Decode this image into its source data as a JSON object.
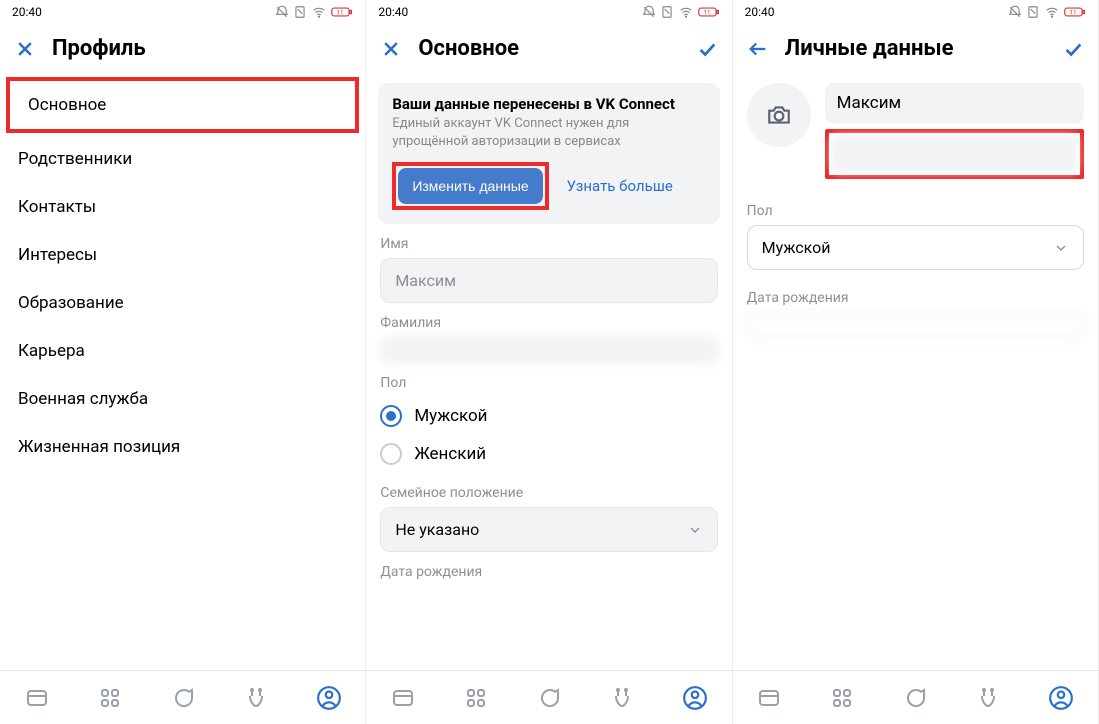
{
  "status": {
    "time": "20:40"
  },
  "panel1": {
    "title": "Профиль",
    "items": [
      "Основное",
      "Родственники",
      "Контакты",
      "Интересы",
      "Образование",
      "Карьера",
      "Военная служба",
      "Жизненная позиция"
    ]
  },
  "panel2": {
    "title": "Основное",
    "notice": {
      "title": "Ваши данные перенесены в VK Connect",
      "sub": "Единый аккаунт VK Connect нужен для упрощённой авторизации в сервисах",
      "primary": "Изменить данные",
      "link": "Узнать больше"
    },
    "name_label": "Имя",
    "name_value": "Максим",
    "surname_label": "Фамилия",
    "surname_value": " ",
    "gender_label": "Пол",
    "gender_male": "Мужской",
    "gender_female": "Женский",
    "marital_label": "Семейное положение",
    "marital_value": "Не указано",
    "birth_label": "Дата рождения"
  },
  "panel3": {
    "title": "Личные данные",
    "first_name": "Максим",
    "surname_value": " ",
    "gender_label": "Пол",
    "gender_value": "Мужской",
    "birth_label": "Дата рождения",
    "birth_value": " "
  }
}
